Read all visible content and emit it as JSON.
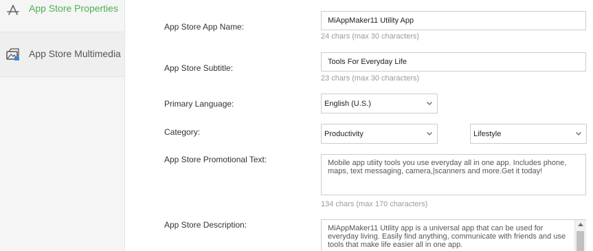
{
  "sidebar": {
    "items": [
      {
        "label": "App Store Properties",
        "icon": "app-store-icon",
        "active": true
      },
      {
        "label": "App Store Multimedia",
        "icon": "multimedia-icon",
        "active": false
      }
    ]
  },
  "form": {
    "app_name": {
      "label": "App Store App Name:",
      "value": "MiAppMaker11 Utility App",
      "hint": "24 chars  (max 30 characters)"
    },
    "subtitle": {
      "label": "App Store Subtitle:",
      "value": "Tools For Everyday Life",
      "hint": "23 chars  (max 30 characters)"
    },
    "primary_language": {
      "label": "Primary Language:",
      "selected": "English (U.S.)"
    },
    "category": {
      "label": "Category:",
      "primary_selected": "Productivity",
      "secondary_selected": "Lifestyle"
    },
    "promotional_text": {
      "label": "App Store Promotional Text:",
      "value": "Mobile app utiity tools you use everyday all in one app. Includes phone, maps, text messaging, camera,|scanners and more.Get it today!",
      "hint": "134 chars  (max 170 characters)"
    },
    "description": {
      "label": "App Store Description:",
      "value": "MiAppMaker11 Utility app is a universal app that can be used for everyday living. Easily find anything, communicate with friends and use tools that make life easier all in one app."
    }
  },
  "colors": {
    "accent": "#4caf50",
    "sidebar_bg": "#f5f5f5",
    "border": "#cccccc",
    "hint_text": "#999999"
  }
}
